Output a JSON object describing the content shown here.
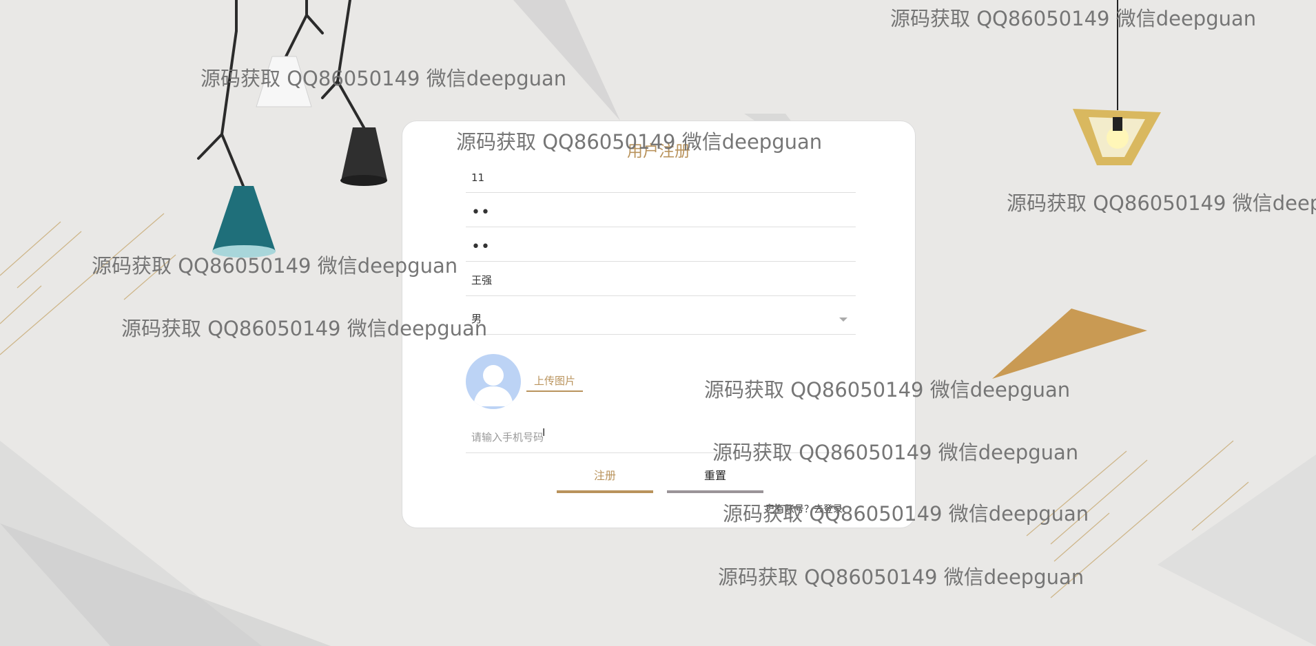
{
  "form": {
    "title": "用户注册",
    "username_value": "11",
    "password_value": "••",
    "confirm_password_value": "••",
    "name_value": "王强",
    "gender_selected": "男",
    "upload_button_label": "上传图片",
    "phone_placeholder": "请输入手机号码",
    "register_button_label": "注册",
    "reset_button_label": "重置",
    "login_link_text": "已有账号？去登录"
  },
  "watermark": "源码获取 QQ86050149 微信deepguan",
  "colors": {
    "accent": "#b9935c",
    "avatar_bg": "#bcd3f5",
    "reset_underline": "#9a9498",
    "background": "#e9e8e6"
  }
}
